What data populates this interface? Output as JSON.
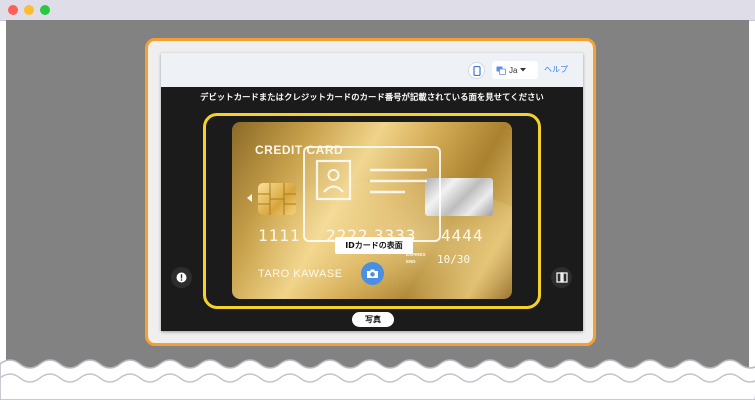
{
  "window": {
    "traffic_lights": [
      {
        "name": "close",
        "color": "#ff5f57"
      },
      {
        "name": "minimize",
        "color": "#febc2e"
      },
      {
        "name": "maximize",
        "color": "#28c840"
      }
    ]
  },
  "header": {
    "phone_icon": "phone-icon",
    "language_icon": "translate-icon",
    "language_label": "Ja",
    "help_label": "ヘルプ"
  },
  "instruction_text": "デビットカードまたはクレジットカードのカード番号が記載されている面を見せてください",
  "card": {
    "brand_label": "CREDIT CARD",
    "number_groups": [
      "1111",
      "2222",
      "3333",
      "4444"
    ],
    "expires_label_1": "EXPIRES",
    "expires_label_2": "END",
    "expiry": "10/30",
    "holder_name": "TARO KAWASE"
  },
  "overlay": {
    "id_label": "IDカードの表面"
  },
  "controls": {
    "camera_icon": "camera-icon",
    "alert_icon": "alert-icon",
    "flip_icon": "flip-camera-icon",
    "photo_label": "写真"
  },
  "colors": {
    "frame_orange": "#f5a033",
    "scan_yellow": "#f5d22a",
    "accent_blue": "#4a90e2",
    "link_blue": "#3d7be0"
  }
}
